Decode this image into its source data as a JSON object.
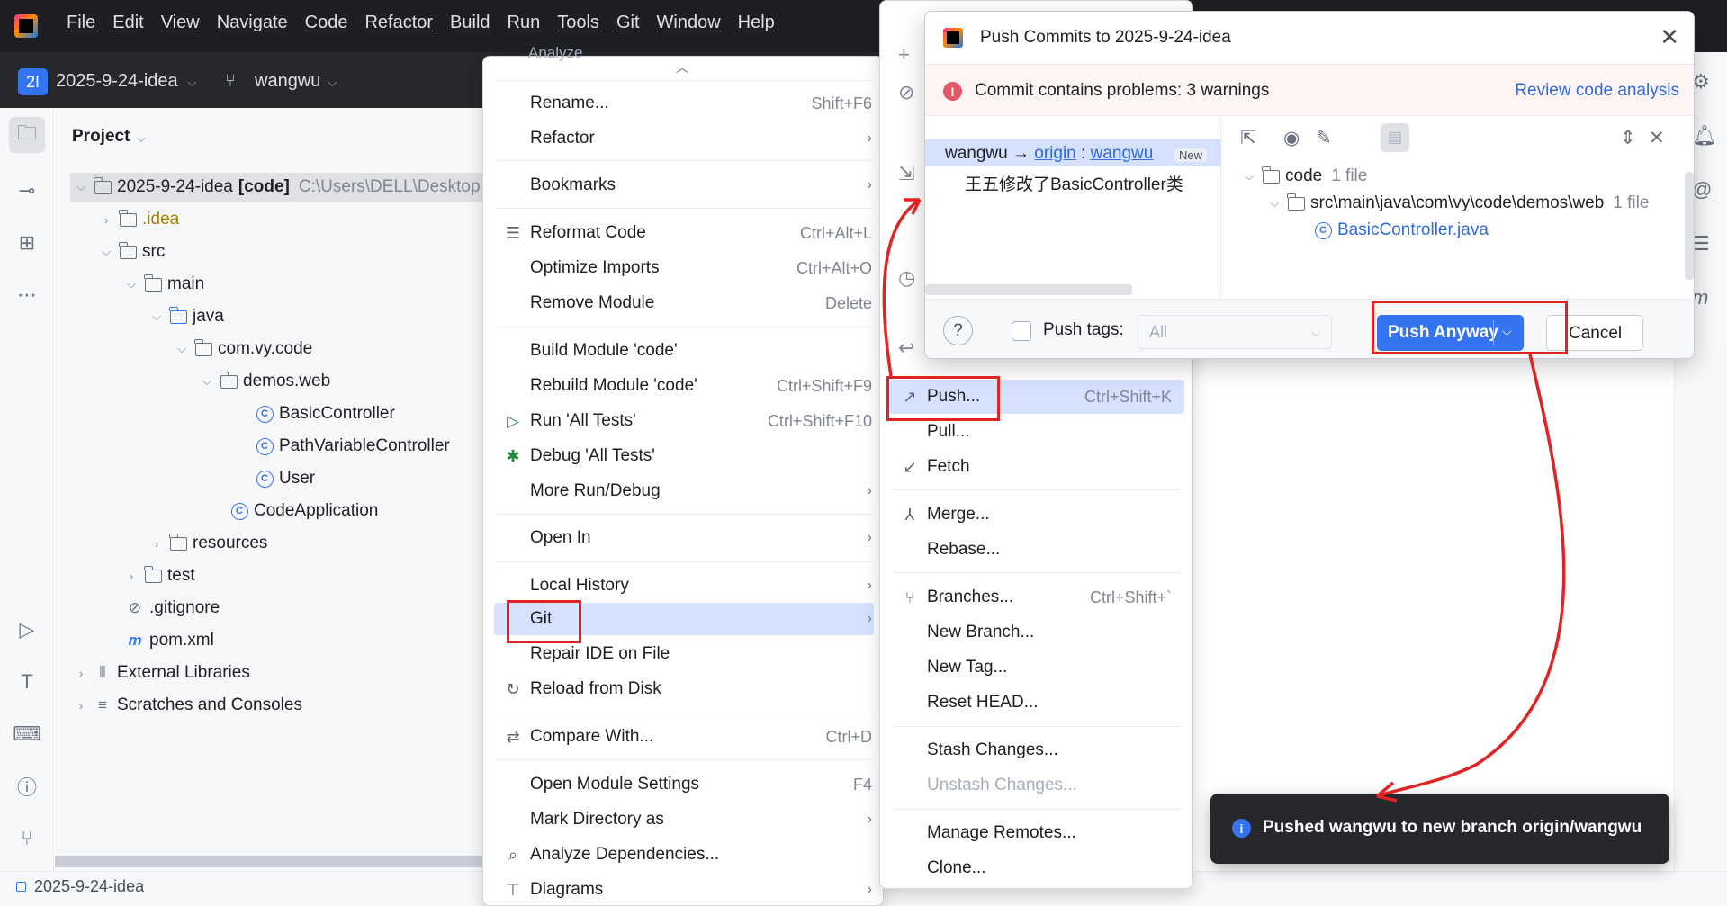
{
  "menubar": {
    "items": [
      "File",
      "Edit",
      "View",
      "Navigate",
      "Code",
      "Refactor",
      "Build",
      "Run",
      "Tools",
      "Git",
      "Window",
      "Help"
    ]
  },
  "toolbar": {
    "project_badge": "2I",
    "project_name": "2025-9-24-idea",
    "branch": "wangwu"
  },
  "project_panel": {
    "title": "Project",
    "tree": [
      {
        "label": "2025-9-24-idea",
        "bold": "[code]",
        "extra": "C:\\Users\\DELL\\Desktop"
      },
      {
        "label": ".idea"
      },
      {
        "label": "src"
      },
      {
        "label": "main"
      },
      {
        "label": "java"
      },
      {
        "label": "com.vy.code"
      },
      {
        "label": "demos.web"
      },
      {
        "label": "BasicController"
      },
      {
        "label": "PathVariableController"
      },
      {
        "label": "User"
      },
      {
        "label": "CodeApplication"
      },
      {
        "label": "resources"
      },
      {
        "label": "test"
      },
      {
        "label": ".gitignore"
      },
      {
        "label": "pom.xml"
      },
      {
        "label": "External Libraries"
      },
      {
        "label": "Scratches and Consoles"
      }
    ]
  },
  "statusbar": {
    "text": "2025-9-24-idea"
  },
  "main_menu": {
    "top_partial": "Analyze",
    "items": [
      {
        "label": "Rename...",
        "shortcut": "Shift+F6"
      },
      {
        "label": "Refactor"
      },
      {
        "label": "Bookmarks"
      },
      {
        "label": "Reformat Code",
        "shortcut": "Ctrl+Alt+L"
      },
      {
        "label": "Optimize Imports",
        "shortcut": "Ctrl+Alt+O"
      },
      {
        "label": "Remove Module",
        "shortcut": "Delete"
      },
      {
        "label": "Build Module 'code'"
      },
      {
        "label": "Rebuild Module 'code'",
        "shortcut": "Ctrl+Shift+F9"
      },
      {
        "label": "Run 'All Tests'",
        "shortcut": "Ctrl+Shift+F10"
      },
      {
        "label": "Debug 'All Tests'"
      },
      {
        "label": "More Run/Debug"
      },
      {
        "label": "Open In"
      },
      {
        "label": "Local History"
      },
      {
        "label": "Git"
      },
      {
        "label": "Repair IDE on File"
      },
      {
        "label": "Reload from Disk"
      },
      {
        "label": "Compare With...",
        "shortcut": "Ctrl+D"
      },
      {
        "label": "Open Module Settings",
        "shortcut": "F4"
      },
      {
        "label": "Mark Directory as"
      },
      {
        "label": "Analyze Dependencies..."
      },
      {
        "label": "Diagrams"
      }
    ]
  },
  "git_menu": {
    "items": [
      {
        "label": "Push...",
        "shortcut": "Ctrl+Shift+K"
      },
      {
        "label": "Pull..."
      },
      {
        "label": "Fetch"
      },
      {
        "label": "Merge..."
      },
      {
        "label": "Rebase..."
      },
      {
        "label": "Branches...",
        "shortcut": "Ctrl+Shift+`"
      },
      {
        "label": "New Branch..."
      },
      {
        "label": "New Tag..."
      },
      {
        "label": "Reset HEAD..."
      },
      {
        "label": "Stash Changes..."
      },
      {
        "label": "Unstash Changes..."
      },
      {
        "label": "Manage Remotes..."
      },
      {
        "label": "Clone..."
      }
    ]
  },
  "push_dialog": {
    "title": "Push Commits to 2025-9-24-idea",
    "warning": "Commit contains problems: 3 warnings",
    "review_link": "Review code analysis",
    "local_branch": "wangwu",
    "arrow": "→",
    "remote": "origin",
    "remote_sep": ":",
    "remote_branch": "wangwu",
    "new_badge": "New",
    "commit_message": "王五修改了BasicController类",
    "files": {
      "root": "code",
      "root_count": "1 file",
      "path": "src\\main\\java\\com\\vy\\code\\demos\\web",
      "path_count": "1 file",
      "file": "BasicController.java"
    },
    "help": "?",
    "push_tags_label": "Push tags:",
    "push_tags_value": "All",
    "push_button": "Push Anyway",
    "cancel_button": "Cancel"
  },
  "notification": {
    "text": "Pushed wangwu to new branch origin/wangwu"
  },
  "colors": {
    "accent": "#3574f0",
    "annotation_red": "#e02424",
    "warning_red": "#e55765",
    "link": "#2f6ad9"
  }
}
